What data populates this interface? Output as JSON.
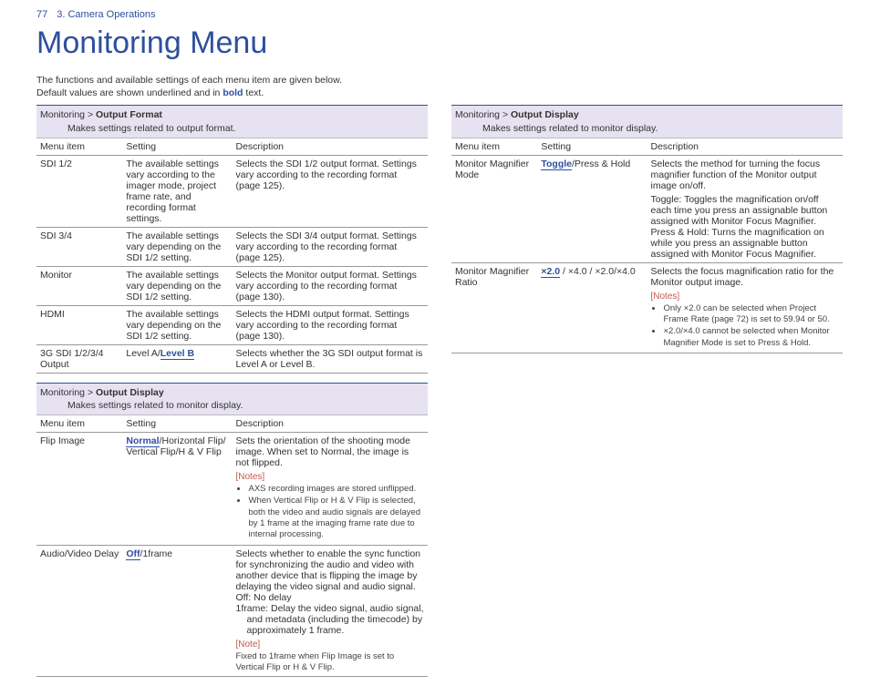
{
  "header": {
    "page": "77",
    "chapter": "3. Camera Operations"
  },
  "title": "Monitoring Menu",
  "intro": {
    "line1": "The functions and available settings of each menu item are given below.",
    "line2_a": "Default values are shown underlined and in ",
    "line2_b": "bold",
    "line2_c": " text."
  },
  "left": {
    "s1": {
      "crumb_a": "Monitoring > ",
      "crumb_b": "Output Format",
      "desc": "Makes settings related to output format.",
      "head": {
        "c1": "Menu item",
        "c2": "Setting",
        "c3": "Description"
      },
      "rows": {
        "r1": {
          "c1": "SDI 1/2",
          "c2": "The available settings vary according to the imager mode, project frame rate, and recording format settings.",
          "c3": "Selects the SDI 1/2 output format. Settings vary according to the recording format (page 125)."
        },
        "r2": {
          "c1": "SDI 3/4",
          "c2": "The available settings vary depending on the SDI 1/2 setting.",
          "c3": "Selects the SDI 3/4 output format. Settings vary according to the recording format (page 125)."
        },
        "r3": {
          "c1": "Monitor",
          "c2": "The available settings vary depending on the SDI 1/2 setting.",
          "c3": "Selects the Monitor output format. Settings vary according to the recording format (page 130)."
        },
        "r4": {
          "c1": "HDMI",
          "c2": "The available settings vary depending on the SDI 1/2 setting.",
          "c3": "Selects the HDMI output format. Settings vary according to the recording format (page 130)."
        },
        "r5": {
          "c1": "3G SDI 1/2/3/4 Output",
          "c2_a": "Level A/",
          "c2_def": "Level B",
          "c3": "Selects whether the 3G SDI output format is Level A or Level B."
        }
      }
    },
    "s2": {
      "crumb_a": "Monitoring > ",
      "crumb_b": "Output Display",
      "desc": "Makes settings related to monitor display.",
      "head": {
        "c1": "Menu item",
        "c2": "Setting",
        "c3": "Description"
      },
      "rows": {
        "r1": {
          "c1": "Flip Image",
          "c2_def": "Normal",
          "c2_rest": "/Horizontal Flip/ Vertical Flip/H & V Flip",
          "c3": "Sets the orientation of the shooting mode image. When set to Normal, the image is not flipped.",
          "notes_title": "[Notes]",
          "notes": {
            "n1": "AXS recording images are stored unflipped.",
            "n2": "When Vertical Flip or H & V Flip is selected, both the video and audio signals are delayed by 1 frame at the imaging frame rate due to internal processing."
          }
        },
        "r2": {
          "c1": "Audio/Video Delay",
          "c2_def": "Off",
          "c2_rest": "/1frame",
          "c3_a": "Selects whether to enable the sync function for synchronizing the audio and video with another device that is flipping the image by delaying the video signal and audio signal.",
          "c3_b": "Off: No delay",
          "c3_c": "1frame: Delay the video signal, audio signal, and metadata (including the timecode) by approximately 1 frame.",
          "note_title": "[Note]",
          "note_text": "Fixed to 1frame when Flip Image is set to Vertical Flip or H & V Flip."
        }
      }
    }
  },
  "right": {
    "s1": {
      "crumb_a": "Monitoring > ",
      "crumb_b": "Output Display",
      "desc": "Makes settings related to monitor display.",
      "head": {
        "c1": "Menu item",
        "c2": "Setting",
        "c3": "Description"
      },
      "rows": {
        "r1": {
          "c1": "Monitor Magnifier Mode",
          "c2_def": "Toggle",
          "c2_rest": "/Press & Hold",
          "c3_a": "Selects the method for turning the focus magnifier function of the Monitor output image on/off.",
          "c3_b": "Toggle: Toggles the magnification on/off each time you press an assignable button assigned with Monitor Focus Magnifier.",
          "c3_c": "Press & Hold: Turns the magnification on while you press an assignable button assigned with Monitor Focus Magnifier."
        },
        "r2": {
          "c1": "Monitor Magnifier Ratio",
          "c2_def": "×2.0",
          "c2_rest": " / ×4.0 / ×2.0/×4.0",
          "c3": "Selects the focus magnification ratio for the Monitor output image.",
          "notes_title": "[Notes]",
          "notes": {
            "n1": "Only ×2.0 can be selected when Project Frame Rate (page 72) is set to 59.94 or 50.",
            "n2": "×2.0/×4.0 cannot be selected when Monitor Magnifier Mode is set to Press & Hold."
          }
        }
      }
    }
  }
}
